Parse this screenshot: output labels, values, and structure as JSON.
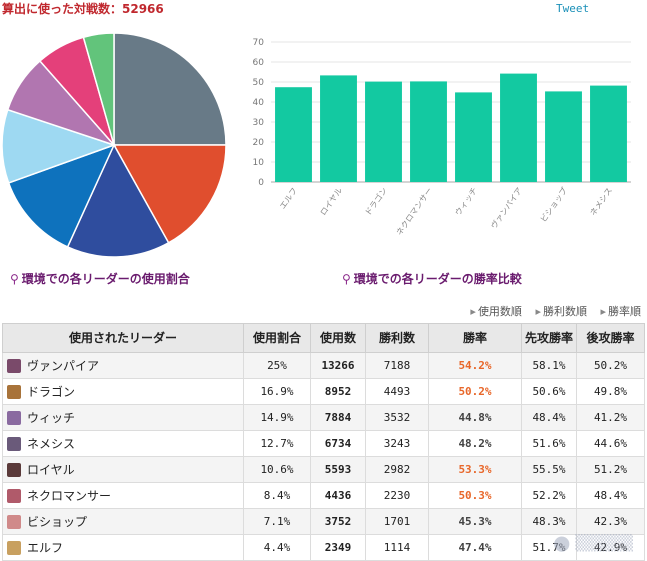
{
  "header": {
    "title": "算出に使った対戦数：52966",
    "tweet_label": "Tweet"
  },
  "captions": {
    "pie": "環境での各リーダーの使用割合",
    "bar": "環境での各リーダーの勝率比較"
  },
  "sort_links": [
    "使用数順",
    "勝利数順",
    "勝率順"
  ],
  "chart_data": [
    {
      "type": "pie",
      "categories": [
        "ヴァンパイア",
        "ドラゴン",
        "ウィッチ",
        "ネメシス",
        "ロイヤル",
        "ネクロマンサー",
        "ビショップ",
        "エルフ"
      ],
      "values": [
        25,
        16.9,
        14.9,
        12.7,
        10.6,
        8.4,
        7.1,
        4.4
      ],
      "colors": [
        "#687a87",
        "#e04e2e",
        "#2f4d9e",
        "#0e72bd",
        "#9ed9f2",
        "#b176b0",
        "#e4407a",
        "#62c47b"
      ]
    },
    {
      "type": "bar",
      "categories": [
        "エルフ",
        "ロイヤル",
        "ドラゴン",
        "ネクロマンサー",
        "ウィッチ",
        "ヴァンパイア",
        "ビショップ",
        "ネメシス"
      ],
      "values": [
        47.4,
        53.3,
        50.2,
        50.3,
        44.8,
        54.2,
        45.3,
        48.2
      ],
      "ylim": [
        0,
        70
      ],
      "yticks": [
        "0",
        "10",
        "20",
        "30",
        "40",
        "50",
        "60",
        "70"
      ],
      "color": "#13c9a1",
      "grid": true
    }
  ],
  "table": {
    "headers": [
      "使用されたリーダー",
      "使用割合",
      "使用数",
      "勝利数",
      "勝率",
      "先攻勝率",
      "後攻勝率"
    ],
    "rows": [
      {
        "name": "ヴァンパイア",
        "share": "25%",
        "count": "13266",
        "wins": "7188",
        "win_rate": "54.2%",
        "first": "58.1%",
        "second": "50.2%",
        "rate_color": "#e8672a"
      },
      {
        "name": "ドラゴン",
        "share": "16.9%",
        "count": "8952",
        "wins": "4493",
        "win_rate": "50.2%",
        "first": "50.6%",
        "second": "49.8%",
        "rate_color": "#e8672a"
      },
      {
        "name": "ウィッチ",
        "share": "14.9%",
        "count": "7884",
        "wins": "3532",
        "win_rate": "44.8%",
        "first": "48.4%",
        "second": "41.2%",
        "rate_color": "#444444"
      },
      {
        "name": "ネメシス",
        "share": "12.7%",
        "count": "6734",
        "wins": "3243",
        "win_rate": "48.2%",
        "first": "51.6%",
        "second": "44.6%",
        "rate_color": "#444444"
      },
      {
        "name": "ロイヤル",
        "share": "10.6%",
        "count": "5593",
        "wins": "2982",
        "win_rate": "53.3%",
        "first": "55.5%",
        "second": "51.2%",
        "rate_color": "#e8672a"
      },
      {
        "name": "ネクロマンサー",
        "share": "8.4%",
        "count": "4436",
        "wins": "2230",
        "win_rate": "50.3%",
        "first": "52.2%",
        "second": "48.4%",
        "rate_color": "#e8672a"
      },
      {
        "name": "ビショップ",
        "share": "7.1%",
        "count": "3752",
        "wins": "1701",
        "win_rate": "45.3%",
        "first": "48.3%",
        "second": "42.3%",
        "rate_color": "#444444"
      },
      {
        "name": "エルフ",
        "share": "4.4%",
        "count": "2349",
        "wins": "1114",
        "win_rate": "47.4%",
        "first": "51.7%",
        "second": "42.9%",
        "rate_color": "#444444"
      }
    ]
  }
}
